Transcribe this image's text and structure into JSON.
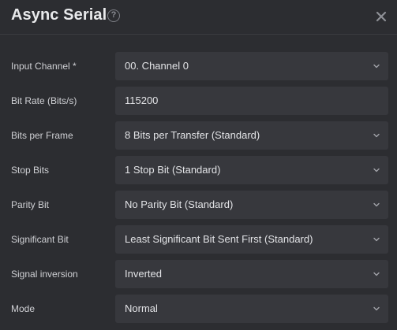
{
  "dialog": {
    "title": "Async Serial",
    "help_icon": "question-circle-icon",
    "help_glyph": "?",
    "close_icon": "close-icon"
  },
  "fields": [
    {
      "label": "Input Channel *",
      "value": "00.  Channel 0",
      "type": "select"
    },
    {
      "label": "Bit Rate (Bits/s)",
      "value": "115200",
      "type": "input"
    },
    {
      "label": "Bits per Frame",
      "value": "8 Bits per Transfer (Standard)",
      "type": "select"
    },
    {
      "label": "Stop Bits",
      "value": "1 Stop Bit (Standard)",
      "type": "select"
    },
    {
      "label": "Parity Bit",
      "value": "No Parity Bit (Standard)",
      "type": "select"
    },
    {
      "label": "Significant Bit",
      "value": "Least Significant Bit Sent First (Standard)",
      "type": "select"
    },
    {
      "label": "Signal inversion",
      "value": "Inverted",
      "type": "select"
    },
    {
      "label": "Mode",
      "value": "Normal",
      "type": "select"
    }
  ],
  "colors": {
    "background": "#2c2d31",
    "field_background": "#37383d",
    "text": "#d6d7da"
  }
}
